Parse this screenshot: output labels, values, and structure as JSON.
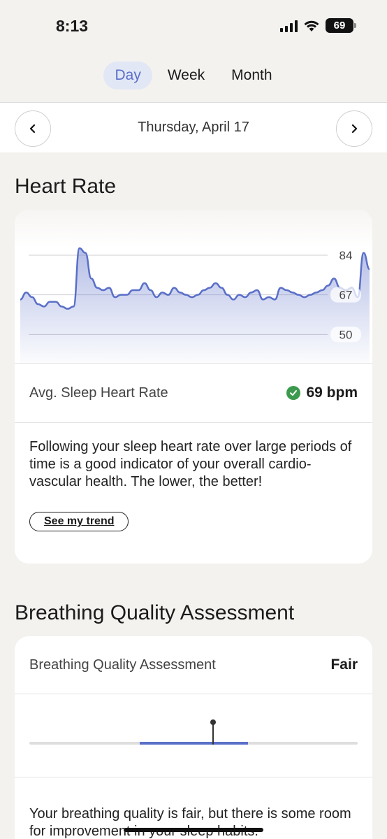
{
  "status_bar": {
    "time": "8:13",
    "battery": "69"
  },
  "tabs": [
    {
      "label": "Day",
      "active": true
    },
    {
      "label": "Week",
      "active": false
    },
    {
      "label": "Month",
      "active": false
    }
  ],
  "date_nav": {
    "date": "Thursday, April 17"
  },
  "heart_rate": {
    "section_title": "Heart Rate",
    "chart_data": {
      "type": "area",
      "title": "",
      "y_ticks": [
        "84",
        "67",
        "50"
      ],
      "ylim": [
        45,
        90
      ],
      "grid": true,
      "color": "#5a6fc8",
      "values": [
        65,
        68,
        66,
        63,
        62,
        64,
        64,
        62,
        61,
        62,
        87,
        85,
        74,
        70,
        69,
        70,
        66,
        67,
        67,
        69,
        69,
        72,
        69,
        66,
        68,
        67,
        70,
        68,
        67,
        66,
        67,
        69,
        70,
        72,
        70,
        67,
        65,
        67,
        66,
        68,
        69,
        65,
        66,
        65,
        70,
        69,
        68,
        67,
        66,
        67,
        68,
        69,
        71,
        74,
        70,
        69,
        70,
        66,
        85,
        78
      ]
    },
    "avg_label": "Avg. Sleep Heart Rate",
    "avg_value": "69 bpm",
    "description": "Following your sleep heart rate over large periods of time is a good indicator of your overall cardio-vascular health. The lower, the better!",
    "trend_button": "See my trend"
  },
  "breathing": {
    "section_title": "Breathing Quality Assessment",
    "row_label": "Breathing Quality Assessment",
    "row_value": "Fair",
    "level": 0.56,
    "description": "Your breathing quality is fair, but there is some room for improvement in your sleep habits."
  },
  "colors": {
    "accent": "#5a6fc8",
    "good": "#3c9a4e",
    "background": "#f4f2ef"
  }
}
